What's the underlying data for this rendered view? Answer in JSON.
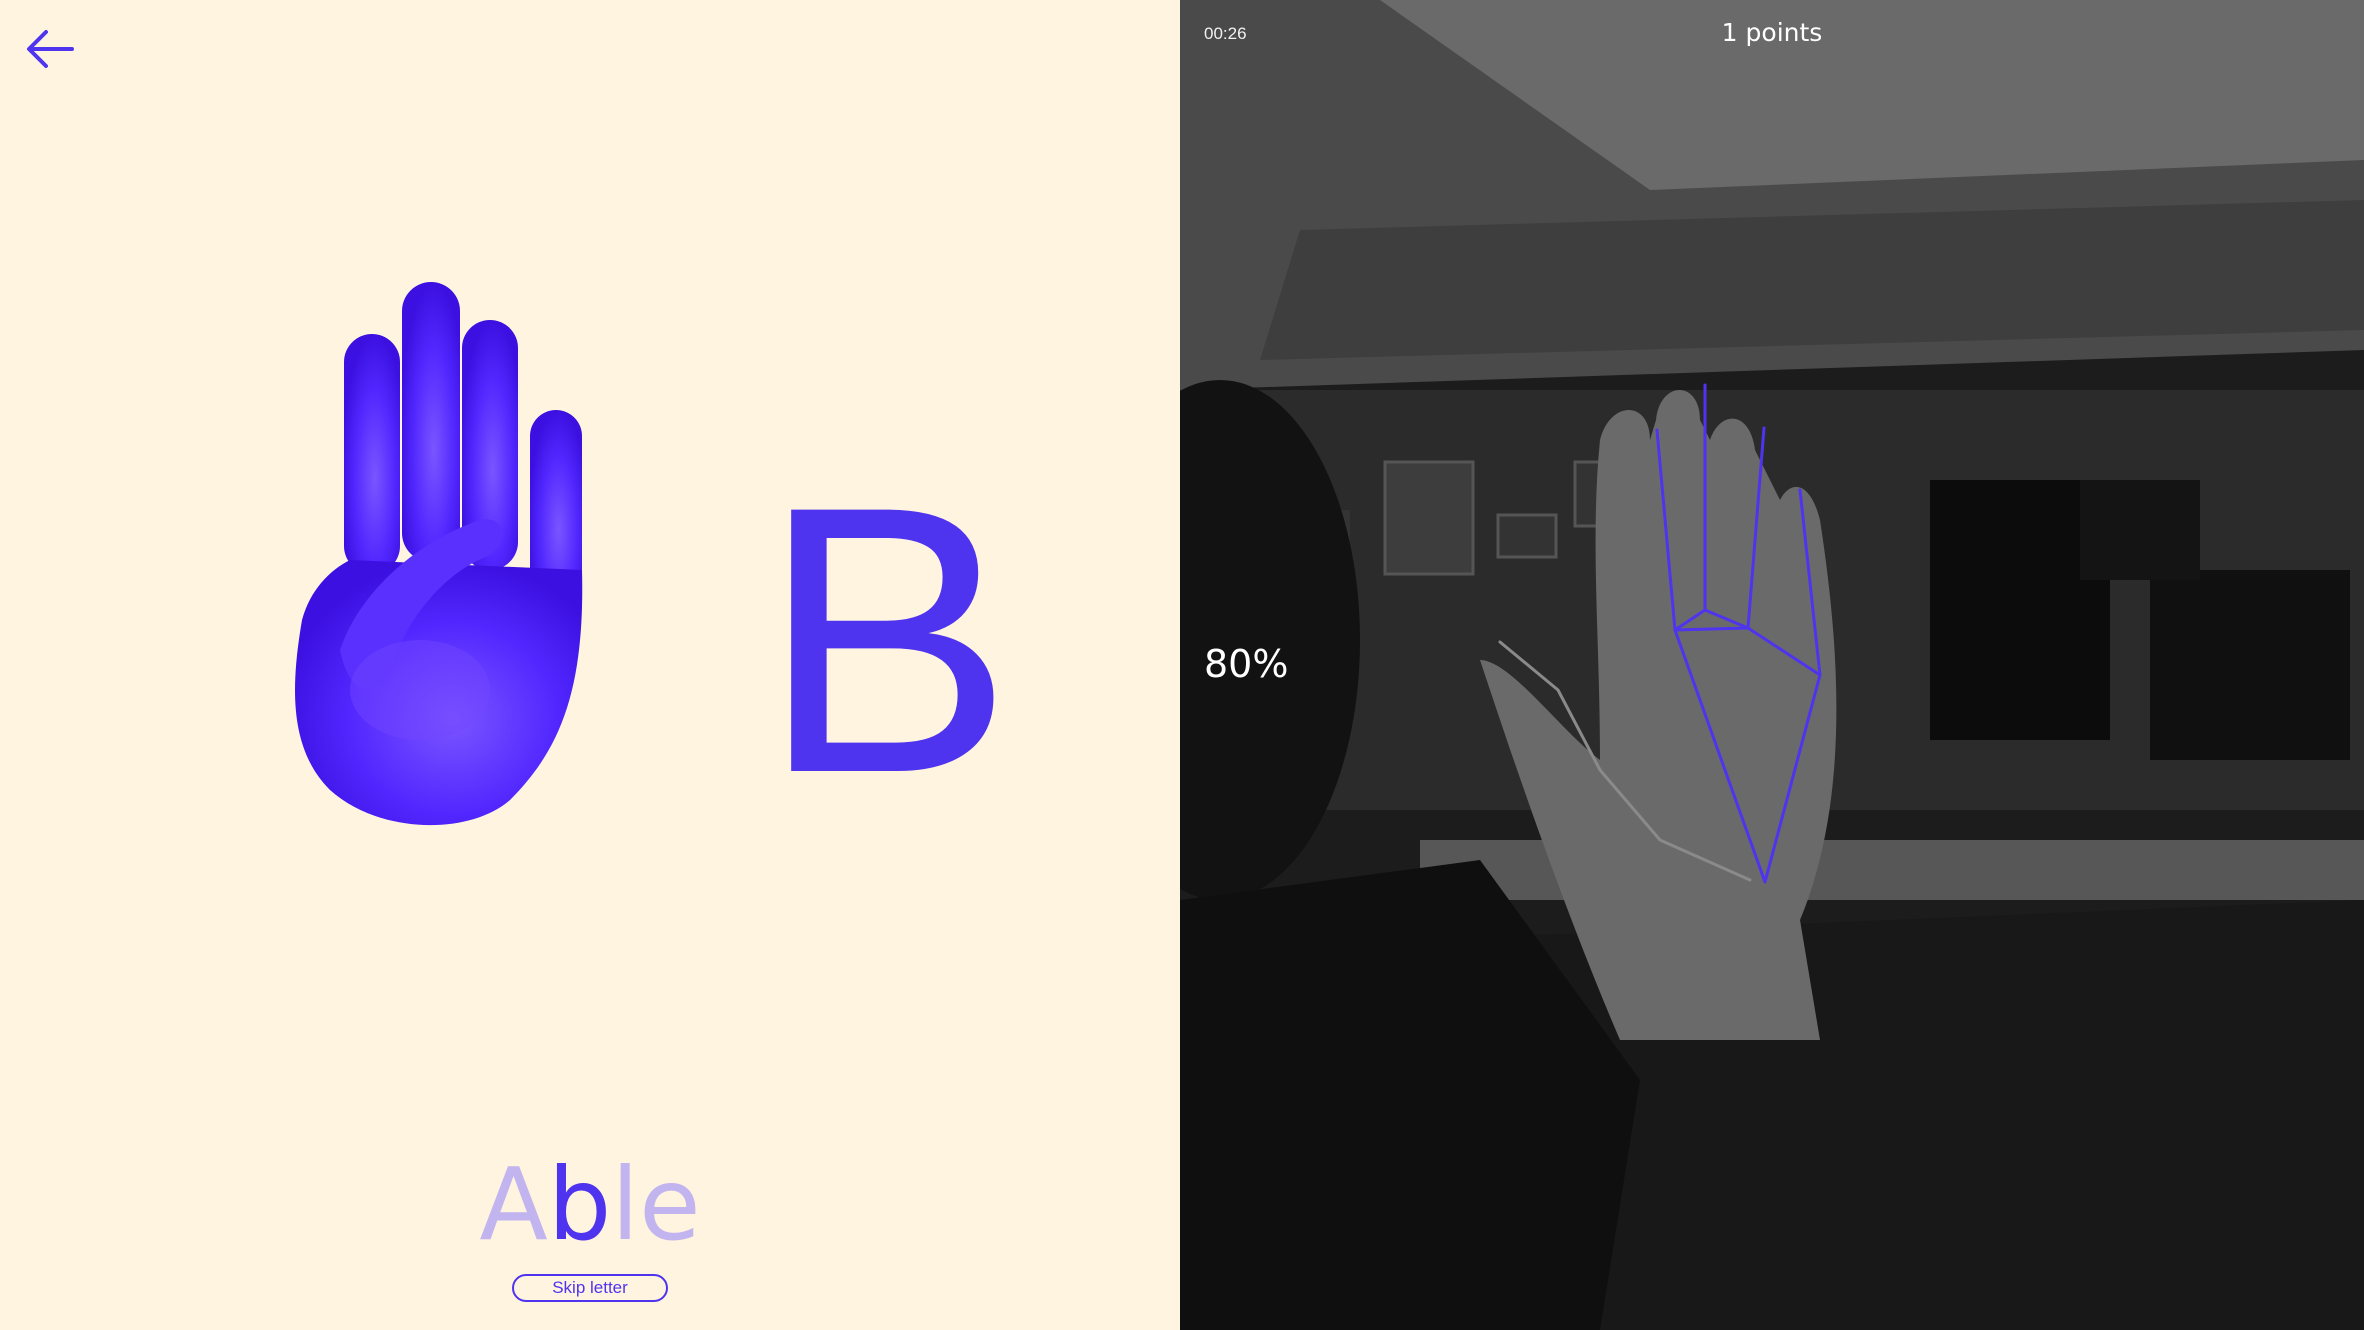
{
  "nav": {
    "back_icon": "arrow-left-icon"
  },
  "lesson": {
    "letter": "B",
    "word": {
      "before": "A",
      "highlight": "b",
      "after": "le"
    },
    "skip_label": "Skip letter",
    "hand_icon": "sign-language-b-hand-icon"
  },
  "camera": {
    "timer": "00:26",
    "points": "1 points",
    "confidence": "80%"
  },
  "colors": {
    "accent": "#4f34ef",
    "accent_light": "#c2b4ef",
    "left_bg": "#fff4df",
    "camera_bg": "#161616"
  }
}
